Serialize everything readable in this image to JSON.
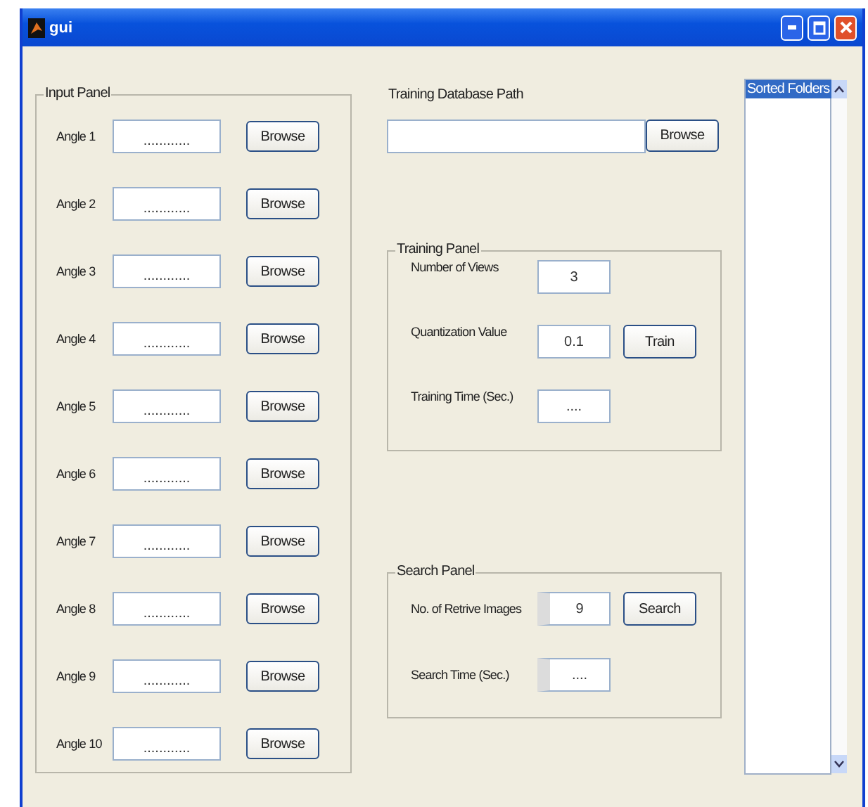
{
  "window": {
    "title": "gui"
  },
  "input_panel": {
    "title": "Input Panel",
    "rows": [
      {
        "label": "Angle 1",
        "value": "............",
        "button": "Browse"
      },
      {
        "label": "Angle 2",
        "value": "............",
        "button": "Browse"
      },
      {
        "label": "Angle 3",
        "value": "............",
        "button": "Browse"
      },
      {
        "label": "Angle 4",
        "value": "............",
        "button": "Browse"
      },
      {
        "label": "Angle 5",
        "value": "............",
        "button": "Browse"
      },
      {
        "label": "Angle 6",
        "value": "............",
        "button": "Browse"
      },
      {
        "label": "Angle 7",
        "value": "............",
        "button": "Browse"
      },
      {
        "label": "Angle 8",
        "value": "............",
        "button": "Browse"
      },
      {
        "label": "Angle 9",
        "value": "............",
        "button": "Browse"
      },
      {
        "label": "Angle 10",
        "value": "............",
        "button": "Browse"
      }
    ]
  },
  "training_path": {
    "label": "Training Database Path",
    "button": "Browse"
  },
  "training_panel": {
    "title": "Training Panel",
    "fields": [
      {
        "label": "Number of Views",
        "value": "3"
      },
      {
        "label": "Quantization Value",
        "value": "0.1",
        "button": "Train"
      },
      {
        "label": "Training Time (Sec.)",
        "value": "...."
      }
    ]
  },
  "search_panel": {
    "title": "Search Panel",
    "fields": [
      {
        "label": "No. of Retrive Images",
        "value": "9",
        "button": "Search"
      },
      {
        "label": "Search Time (Sec.)",
        "value": "...."
      }
    ]
  },
  "folder_list": {
    "items": [
      {
        "label": "Sorted Folders",
        "selected": true
      }
    ]
  }
}
